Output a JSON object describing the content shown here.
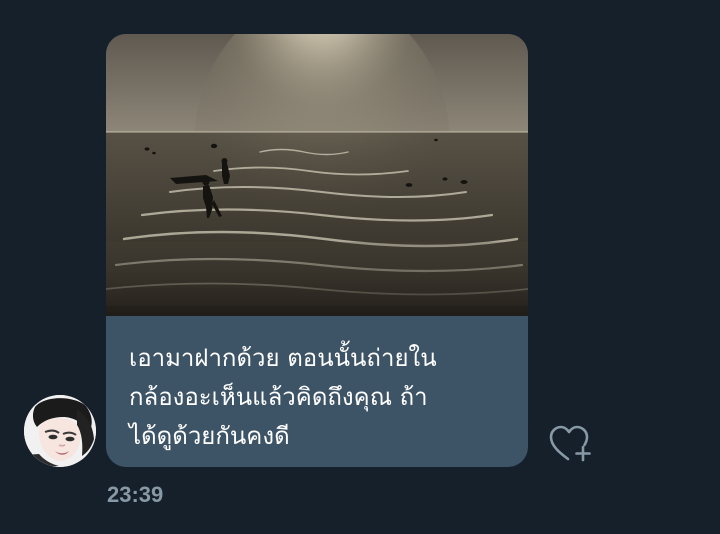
{
  "message": {
    "caption": "เอามาฝากด้วย ตอนนั้นถ่ายใน\nกล้องอะเห็นแล้วคิดถึงคุณ ถ้า\nได้ดูด้วยกันคงดี",
    "timestamp": "23:39"
  },
  "icons": {
    "avatar": "avatar-icon",
    "like": "heart-plus-icon"
  },
  "colors": {
    "background": "#15202b",
    "bubble": "#3d5366",
    "caption_text": "#ffffff",
    "timestamp_text": "#8899a6",
    "icon": "#8899a6"
  }
}
